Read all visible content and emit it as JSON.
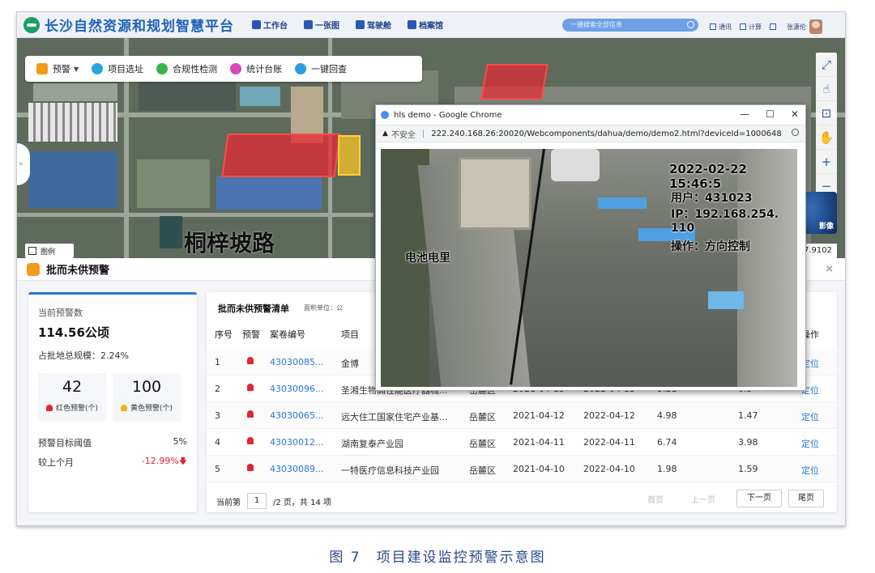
{
  "app": {
    "title": "长沙自然资源和规划智慧平台",
    "nav": [
      {
        "label": "工作台",
        "icon": "workbench-icon"
      },
      {
        "label": "一张图",
        "icon": "map-layer-icon"
      },
      {
        "label": "驾驶舱",
        "icon": "cockpit-icon"
      },
      {
        "label": "档案馆",
        "icon": "archive-icon"
      }
    ],
    "search_placeholder": "一键搜索全部信息",
    "header_right": [
      {
        "label": "通讯",
        "icon": "message-icon"
      },
      {
        "label": "计算",
        "icon": "calculator-icon"
      }
    ],
    "user_name": "张潇伦"
  },
  "toolbar": {
    "items": [
      {
        "label": "预警",
        "icon": "alarm-icon",
        "dropdown": true
      },
      {
        "label": "项目选址",
        "icon": "location-icon"
      },
      {
        "label": "合规性检测",
        "icon": "check-icon"
      },
      {
        "label": "统计台账",
        "icon": "stats-icon"
      },
      {
        "label": "一键回查",
        "icon": "review-icon"
      }
    ]
  },
  "map": {
    "road_label": "桐梓坡路",
    "legend_label": "图例",
    "globe_label": "影像",
    "coord_text": "度: 27.9102",
    "side_tab": "«",
    "controls": [
      "fullscreen-icon",
      "hand-pointer-icon",
      "measure-icon",
      "pan-icon",
      "zoom-in-icon",
      "zoom-out-icon"
    ]
  },
  "panel": {
    "title": "批而未供预警",
    "close": "×",
    "stats": {
      "current_label": "当前预警数",
      "current_value": "114.56公顷",
      "ratio_text": "占批地总规模：2.24%",
      "red_count": "42",
      "red_label": "红色预警(个)",
      "yellow_count": "100",
      "yellow_label": "黄色预警(个)",
      "threshold_label": "预警目标阈值",
      "threshold_value": "5%",
      "mom_label": "较上个月",
      "mom_value": "-12.99%",
      "red_color": "#e0262f",
      "yellow_color": "#f3b41e"
    },
    "list": {
      "title": "批而未供预警清单",
      "unit": "面积单位：公",
      "headers": {
        "index": "序号",
        "alarm": "预警",
        "case_no": "案卷编号",
        "project": "项目",
        "action": "操作"
      },
      "rows": [
        {
          "index": "1",
          "case_no": "43030085...",
          "project": "金博",
          "district": "",
          "date1": "",
          "date2": "",
          "area1": "",
          "area2": "",
          "action": "定位"
        },
        {
          "index": "2",
          "case_no": "43030096...",
          "project": "圣湘生物高性能医疗器械...",
          "district": "岳麓区",
          "date1": "2021-04-13",
          "date2": "2022-04-13",
          "area1": "5.21",
          "area2": "0.5",
          "action": "定位"
        },
        {
          "index": "3",
          "case_no": "43030065...",
          "project": "远大住工国家住宅产业基...",
          "district": "岳麓区",
          "date1": "2021-04-12",
          "date2": "2022-04-12",
          "area1": "4.98",
          "area2": "1.47",
          "action": "定位"
        },
        {
          "index": "4",
          "case_no": "43030012...",
          "project": "湖南复泰产业园",
          "district": "岳麓区",
          "date1": "2021-04-11",
          "date2": "2022-04-11",
          "area1": "6.74",
          "area2": "3.98",
          "action": "定位"
        },
        {
          "index": "5",
          "case_no": "43030089...",
          "project": "一特医疗信息科技产业园",
          "district": "岳麓区",
          "date1": "2021-04-10",
          "date2": "2022-04-10",
          "area1": "1.98",
          "area2": "1.59",
          "action": "定位"
        }
      ],
      "pager": {
        "current_label": "当前第",
        "page": "1",
        "total_text": "/2 页，共 14 项",
        "first": "首页",
        "prev": "上一页",
        "next": "下一页",
        "last": "尾页"
      }
    }
  },
  "chrome": {
    "title": "hls demo - Google Chrome",
    "insecure": "不安全",
    "url": "222.240.168.26:20020/Webcomponents/dahua/demo/demo2.html?deviceId=1000648",
    "osd_time": "2022-02-22 15:46:5",
    "osd_user": "用户：431023",
    "osd_ip": "IP：192.168.254.",
    "osd_ip2": "110",
    "osd_op": "操作：方向控制",
    "osd_cam": "电池电里"
  },
  "caption": "图 7　项目建设监控预警示意图"
}
